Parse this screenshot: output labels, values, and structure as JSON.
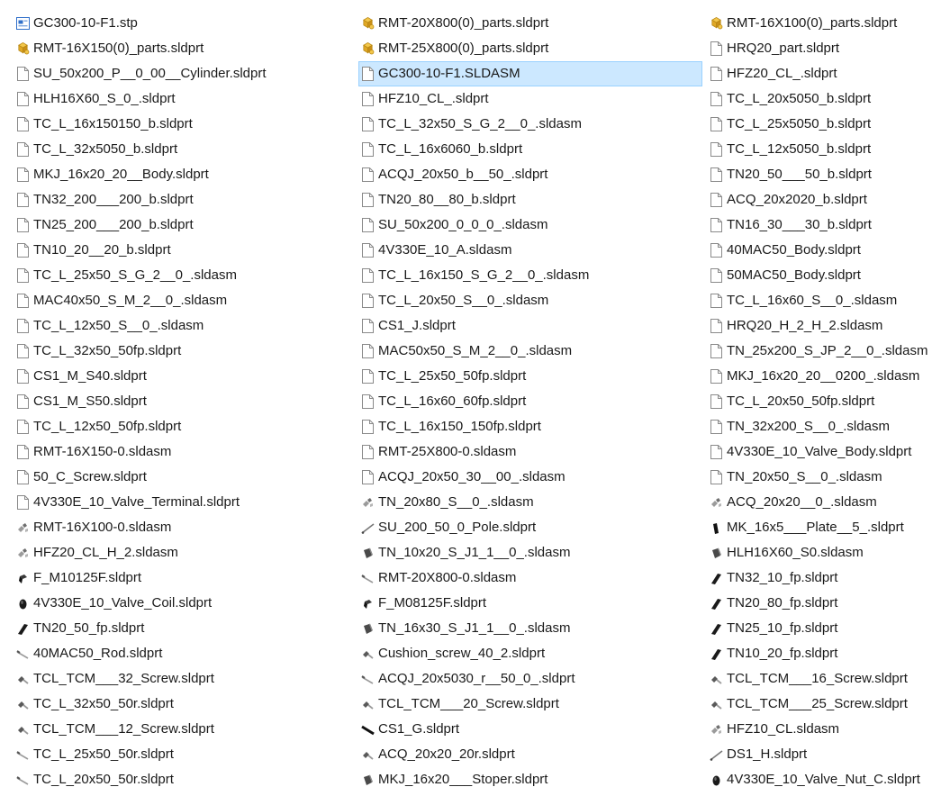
{
  "columns": [
    {
      "items": [
        {
          "name": "GC300-10-F1.stp",
          "icon": "stp"
        },
        {
          "name": "RMT-16X150(0)_parts.sldprt",
          "icon": "parts"
        },
        {
          "name": "SU_50x200_P__0_00__Cylinder.sldprt",
          "icon": "doc"
        },
        {
          "name": "HLH16X60_S_0_.sldprt",
          "icon": "doc"
        },
        {
          "name": "TC_L_16x150150_b.sldprt",
          "icon": "doc"
        },
        {
          "name": "TC_L_32x5050_b.sldprt",
          "icon": "doc"
        },
        {
          "name": "MKJ_16x20_20__Body.sldprt",
          "icon": "doc"
        },
        {
          "name": "TN32_200___200_b.sldprt",
          "icon": "doc"
        },
        {
          "name": "TN25_200___200_b.sldprt",
          "icon": "doc"
        },
        {
          "name": "TN10_20__20_b.sldprt",
          "icon": "doc"
        },
        {
          "name": "TC_L_25x50_S_G_2__0_.sldasm",
          "icon": "doc"
        },
        {
          "name": "MAC40x50_S_M_2__0_.sldasm",
          "icon": "doc"
        },
        {
          "name": "TC_L_12x50_S__0_.sldasm",
          "icon": "doc"
        },
        {
          "name": "TC_L_32x50_50fp.sldprt",
          "icon": "doc"
        },
        {
          "name": "CS1_M_S40.sldprt",
          "icon": "doc"
        },
        {
          "name": "CS1_M_S50.sldprt",
          "icon": "doc"
        },
        {
          "name": "TC_L_12x50_50fp.sldprt",
          "icon": "doc"
        },
        {
          "name": "RMT-16X150-0.sldasm",
          "icon": "doc"
        },
        {
          "name": "50_C_Screw.sldprt",
          "icon": "doc"
        },
        {
          "name": "4V330E_10_Valve_Terminal.sldprt",
          "icon": "doc"
        },
        {
          "name": "RMT-16X100-0.sldasm",
          "icon": "thumb-asm"
        },
        {
          "name": "HFZ20_CL_H_2.sldasm",
          "icon": "thumb-asm"
        },
        {
          "name": "F_M10125F.sldprt",
          "icon": "thumb-nut"
        },
        {
          "name": "4V330E_10_Valve_Coil.sldprt",
          "icon": "thumb-coil"
        },
        {
          "name": "TN20_50_fp.sldprt",
          "icon": "thumb-plate"
        },
        {
          "name": "40MAC50_Rod.sldprt",
          "icon": "thumb-rod"
        },
        {
          "name": "TCL_TCM___32_Screw.sldprt",
          "icon": "thumb-screw"
        },
        {
          "name": "TC_L_32x50_50r.sldprt",
          "icon": "thumb-screw"
        },
        {
          "name": "TCL_TCM___12_Screw.sldprt",
          "icon": "thumb-screw"
        },
        {
          "name": "TC_L_25x50_50r.sldprt",
          "icon": "thumb-rod"
        },
        {
          "name": "TC_L_20x50_50r.sldprt",
          "icon": "thumb-rod"
        }
      ]
    },
    {
      "items": [
        {
          "name": "RMT-20X800(0)_parts.sldprt",
          "icon": "parts"
        },
        {
          "name": "RMT-25X800(0)_parts.sldprt",
          "icon": "parts"
        },
        {
          "name": "GC300-10-F1.SLDASM",
          "icon": "doc",
          "selected": true
        },
        {
          "name": "HFZ10_CL_.sldprt",
          "icon": "doc"
        },
        {
          "name": "TC_L_32x50_S_G_2__0_.sldasm",
          "icon": "doc"
        },
        {
          "name": "TC_L_16x6060_b.sldprt",
          "icon": "doc"
        },
        {
          "name": "ACQJ_20x50_b__50_.sldprt",
          "icon": "doc"
        },
        {
          "name": "TN20_80__80_b.sldprt",
          "icon": "doc"
        },
        {
          "name": "SU_50x200_0_0_0_.sldasm",
          "icon": "doc"
        },
        {
          "name": "4V330E_10_A.sldasm",
          "icon": "doc"
        },
        {
          "name": "TC_L_16x150_S_G_2__0_.sldasm",
          "icon": "doc"
        },
        {
          "name": "TC_L_20x50_S__0_.sldasm",
          "icon": "doc"
        },
        {
          "name": "CS1_J.sldprt",
          "icon": "doc"
        },
        {
          "name": "MAC50x50_S_M_2__0_.sldasm",
          "icon": "doc"
        },
        {
          "name": "TC_L_25x50_50fp.sldprt",
          "icon": "doc"
        },
        {
          "name": "TC_L_16x60_60fp.sldprt",
          "icon": "doc"
        },
        {
          "name": "TC_L_16x150_150fp.sldprt",
          "icon": "doc"
        },
        {
          "name": "RMT-25X800-0.sldasm",
          "icon": "doc"
        },
        {
          "name": "ACQJ_20x50_30__00_.sldasm",
          "icon": "doc"
        },
        {
          "name": "TN_20x80_S__0_.sldasm",
          "icon": "thumb-asm"
        },
        {
          "name": "SU_200_50_0_Pole.sldprt",
          "icon": "thumb-pole"
        },
        {
          "name": "TN_10x20_S_J1_1__0_.sldasm",
          "icon": "thumb-block"
        },
        {
          "name": "RMT-20X800-0.sldasm",
          "icon": "thumb-rod"
        },
        {
          "name": "F_M08125F.sldprt",
          "icon": "thumb-nut"
        },
        {
          "name": "TN_16x30_S_J1_1__0_.sldasm",
          "icon": "thumb-block"
        },
        {
          "name": "Cushion_screw_40_2.sldprt",
          "icon": "thumb-screw"
        },
        {
          "name": "ACQJ_20x5030_r__50_0_.sldprt",
          "icon": "thumb-rod"
        },
        {
          "name": "TCL_TCM___20_Screw.sldprt",
          "icon": "thumb-screw"
        },
        {
          "name": "CS1_G.sldprt",
          "icon": "thumb-bar"
        },
        {
          "name": "ACQ_20x20_20r.sldprt",
          "icon": "thumb-screw"
        },
        {
          "name": "MKJ_16x20___Stoper.sldprt",
          "icon": "thumb-block"
        }
      ]
    },
    {
      "items": [
        {
          "name": "RMT-16X100(0)_parts.sldprt",
          "icon": "parts"
        },
        {
          "name": "HRQ20_part.sldprt",
          "icon": "doc"
        },
        {
          "name": "HFZ20_CL_.sldprt",
          "icon": "doc"
        },
        {
          "name": "TC_L_20x5050_b.sldprt",
          "icon": "doc"
        },
        {
          "name": "TC_L_25x5050_b.sldprt",
          "icon": "doc"
        },
        {
          "name": "TC_L_12x5050_b.sldprt",
          "icon": "doc"
        },
        {
          "name": "TN20_50___50_b.sldprt",
          "icon": "doc"
        },
        {
          "name": "ACQ_20x2020_b.sldprt",
          "icon": "doc"
        },
        {
          "name": "TN16_30___30_b.sldprt",
          "icon": "doc"
        },
        {
          "name": "40MAC50_Body.sldprt",
          "icon": "doc"
        },
        {
          "name": "50MAC50_Body.sldprt",
          "icon": "doc"
        },
        {
          "name": "TC_L_16x60_S__0_.sldasm",
          "icon": "doc"
        },
        {
          "name": "HRQ20_H_2_H_2.sldasm",
          "icon": "doc"
        },
        {
          "name": "TN_25x200_S_JP_2__0_.sldasm",
          "icon": "doc"
        },
        {
          "name": "MKJ_16x20_20__0200_.sldasm",
          "icon": "doc"
        },
        {
          "name": "TC_L_20x50_50fp.sldprt",
          "icon": "doc"
        },
        {
          "name": "TN_32x200_S__0_.sldasm",
          "icon": "doc"
        },
        {
          "name": "4V330E_10_Valve_Body.sldprt",
          "icon": "doc"
        },
        {
          "name": "TN_20x50_S__0_.sldasm",
          "icon": "doc"
        },
        {
          "name": "ACQ_20x20__0_.sldasm",
          "icon": "thumb-asm"
        },
        {
          "name": "MK_16x5___Plate__5_.sldprt",
          "icon": "thumb-plate-v"
        },
        {
          "name": "HLH16X60_S0.sldasm",
          "icon": "thumb-block"
        },
        {
          "name": "TN32_10_fp.sldprt",
          "icon": "thumb-plate"
        },
        {
          "name": "TN20_80_fp.sldprt",
          "icon": "thumb-plate"
        },
        {
          "name": "TN25_10_fp.sldprt",
          "icon": "thumb-plate"
        },
        {
          "name": "TN10_20_fp.sldprt",
          "icon": "thumb-plate"
        },
        {
          "name": "TCL_TCM___16_Screw.sldprt",
          "icon": "thumb-screw"
        },
        {
          "name": "TCL_TCM___25_Screw.sldprt",
          "icon": "thumb-screw"
        },
        {
          "name": "HFZ10_CL.sldasm",
          "icon": "thumb-asm"
        },
        {
          "name": "DS1_H.sldprt",
          "icon": "thumb-pole"
        },
        {
          "name": "4V330E_10_Valve_Nut_C.sldprt",
          "icon": "thumb-coil"
        }
      ]
    }
  ],
  "colors": {
    "selected_bg": "#cce8ff",
    "selected_border": "#99d1ff",
    "parts_icon": "#e0a826",
    "stp_icon": "#2f6fc9"
  }
}
